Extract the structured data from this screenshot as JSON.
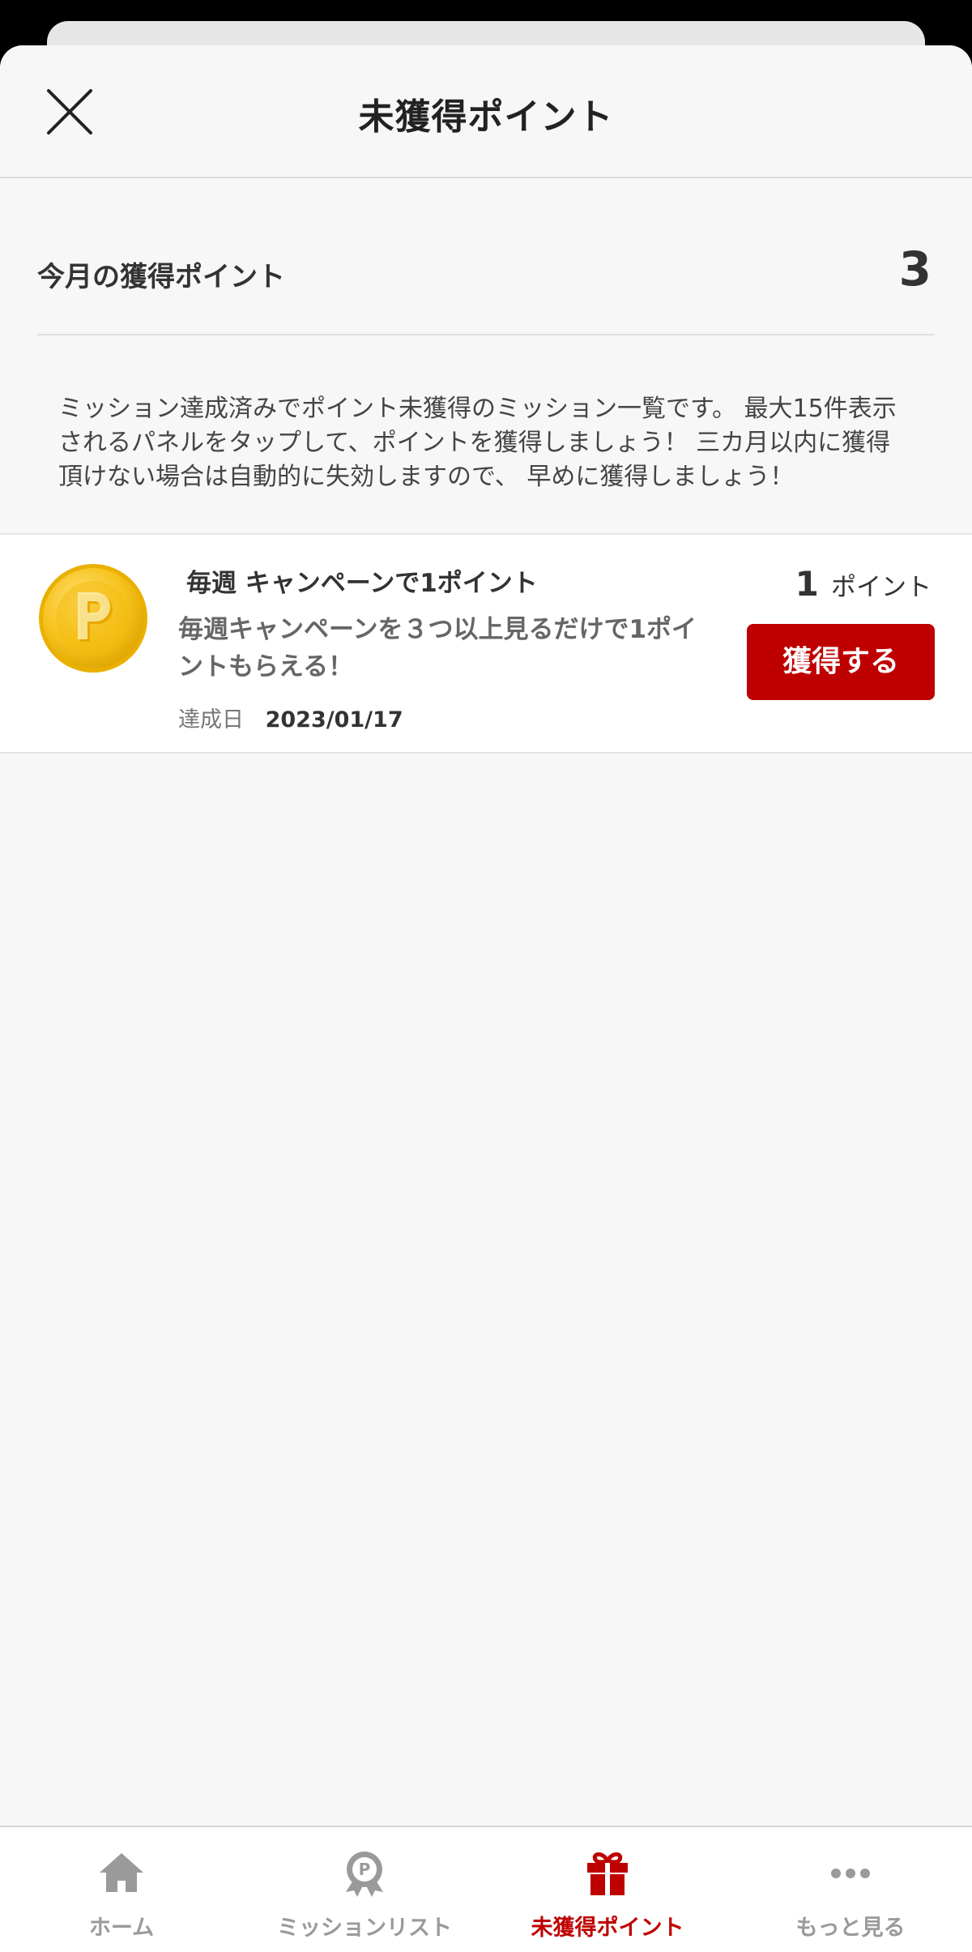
{
  "header": {
    "title": "未獲得ポイント",
    "close_icon": "close-icon"
  },
  "summary": {
    "label": "今月の獲得ポイント",
    "value": "3"
  },
  "description": "ミッション達成済みでポイント未獲得のミッション一覧です。 最大15件表示されるパネルをタップして、ポイントを獲得しましょう！ 三カ月以内に獲得頂けない場合は自動的に失効しますので、 早めに獲得しましょう！",
  "missions": [
    {
      "icon": "coin-icon",
      "title": "毎週 キャンペーンで1ポイント",
      "description": "毎週キャンペーンを３つ以上見るだけで1ポイントもらえる！",
      "date_label": "達成日",
      "date": "2023/01/17",
      "points": "1",
      "points_unit": "ポイント",
      "button_label": "獲得する"
    }
  ],
  "tabbar": {
    "items": [
      {
        "label": "ホーム",
        "icon": "home-icon",
        "active": false
      },
      {
        "label": "ミッションリスト",
        "icon": "medal-icon",
        "active": false
      },
      {
        "label": "未獲得ポイント",
        "icon": "gift-icon",
        "active": true
      },
      {
        "label": "もっと見る",
        "icon": "more-icon",
        "active": false
      }
    ]
  },
  "colors": {
    "accent": "#bf0000",
    "inactive_tab": "#9a9a9a",
    "background": "#f7f7f7"
  }
}
